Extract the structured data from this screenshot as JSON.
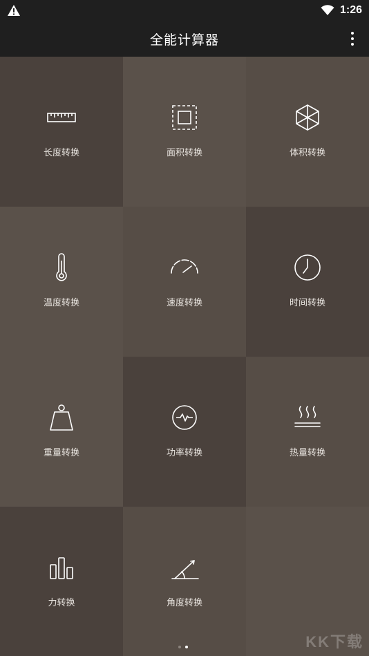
{
  "status_bar": {
    "time": "1:26"
  },
  "app_bar": {
    "title": "全能计算器"
  },
  "tiles": [
    {
      "label": "长度转换",
      "icon": "ruler-icon"
    },
    {
      "label": "面积转换",
      "icon": "area-square-icon"
    },
    {
      "label": "体积转换",
      "icon": "cube-icon"
    },
    {
      "label": "温度转换",
      "icon": "thermometer-icon"
    },
    {
      "label": "速度转换",
      "icon": "speedometer-icon"
    },
    {
      "label": "时间转换",
      "icon": "clock-icon"
    },
    {
      "label": "重量转换",
      "icon": "weight-icon"
    },
    {
      "label": "功率转换",
      "icon": "power-icon"
    },
    {
      "label": "热量转换",
      "icon": "heat-icon"
    },
    {
      "label": "力转换",
      "icon": "force-bars-icon"
    },
    {
      "label": "角度转换",
      "icon": "angle-icon"
    }
  ],
  "pager": {
    "total": 2,
    "current": 2
  },
  "watermark": "KK下载"
}
